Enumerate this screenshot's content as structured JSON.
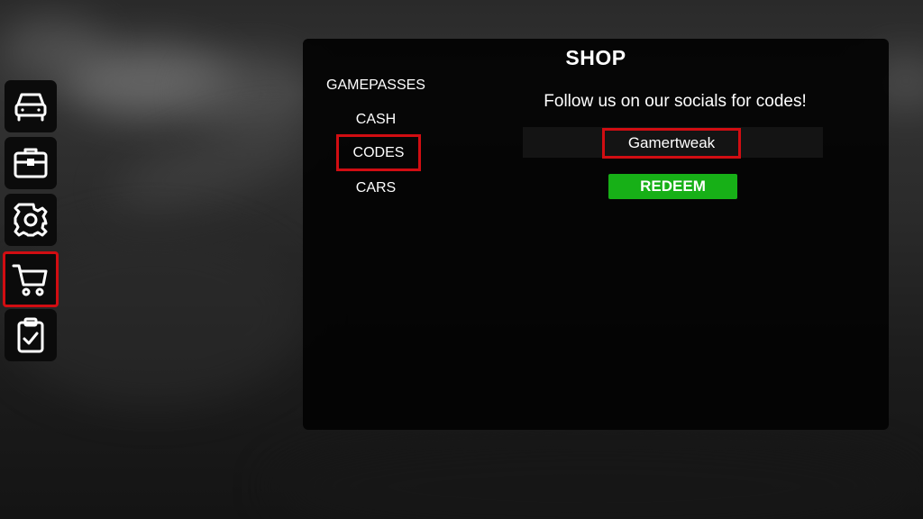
{
  "sidebar": {
    "items": [
      {
        "icon": "car-icon",
        "selected": false
      },
      {
        "icon": "briefcase-icon",
        "selected": false
      },
      {
        "icon": "gear-icon",
        "selected": false
      },
      {
        "icon": "shopping-cart-icon",
        "selected": true
      },
      {
        "icon": "clipboard-check-icon",
        "selected": false
      }
    ]
  },
  "shop": {
    "title": "SHOP",
    "tabs": [
      {
        "label": "GAMEPASSES"
      },
      {
        "label": "CASH"
      },
      {
        "label": "CODES",
        "active": true
      },
      {
        "label": "CARS"
      }
    ],
    "codes": {
      "message": "Follow us on our socials for codes!",
      "code_value": "Gamertweak",
      "redeem_label": "REDEEM"
    }
  },
  "colors": {
    "highlight": "#d10d12",
    "redeem_green": "#17b017",
    "panel_bg": "#030303"
  }
}
